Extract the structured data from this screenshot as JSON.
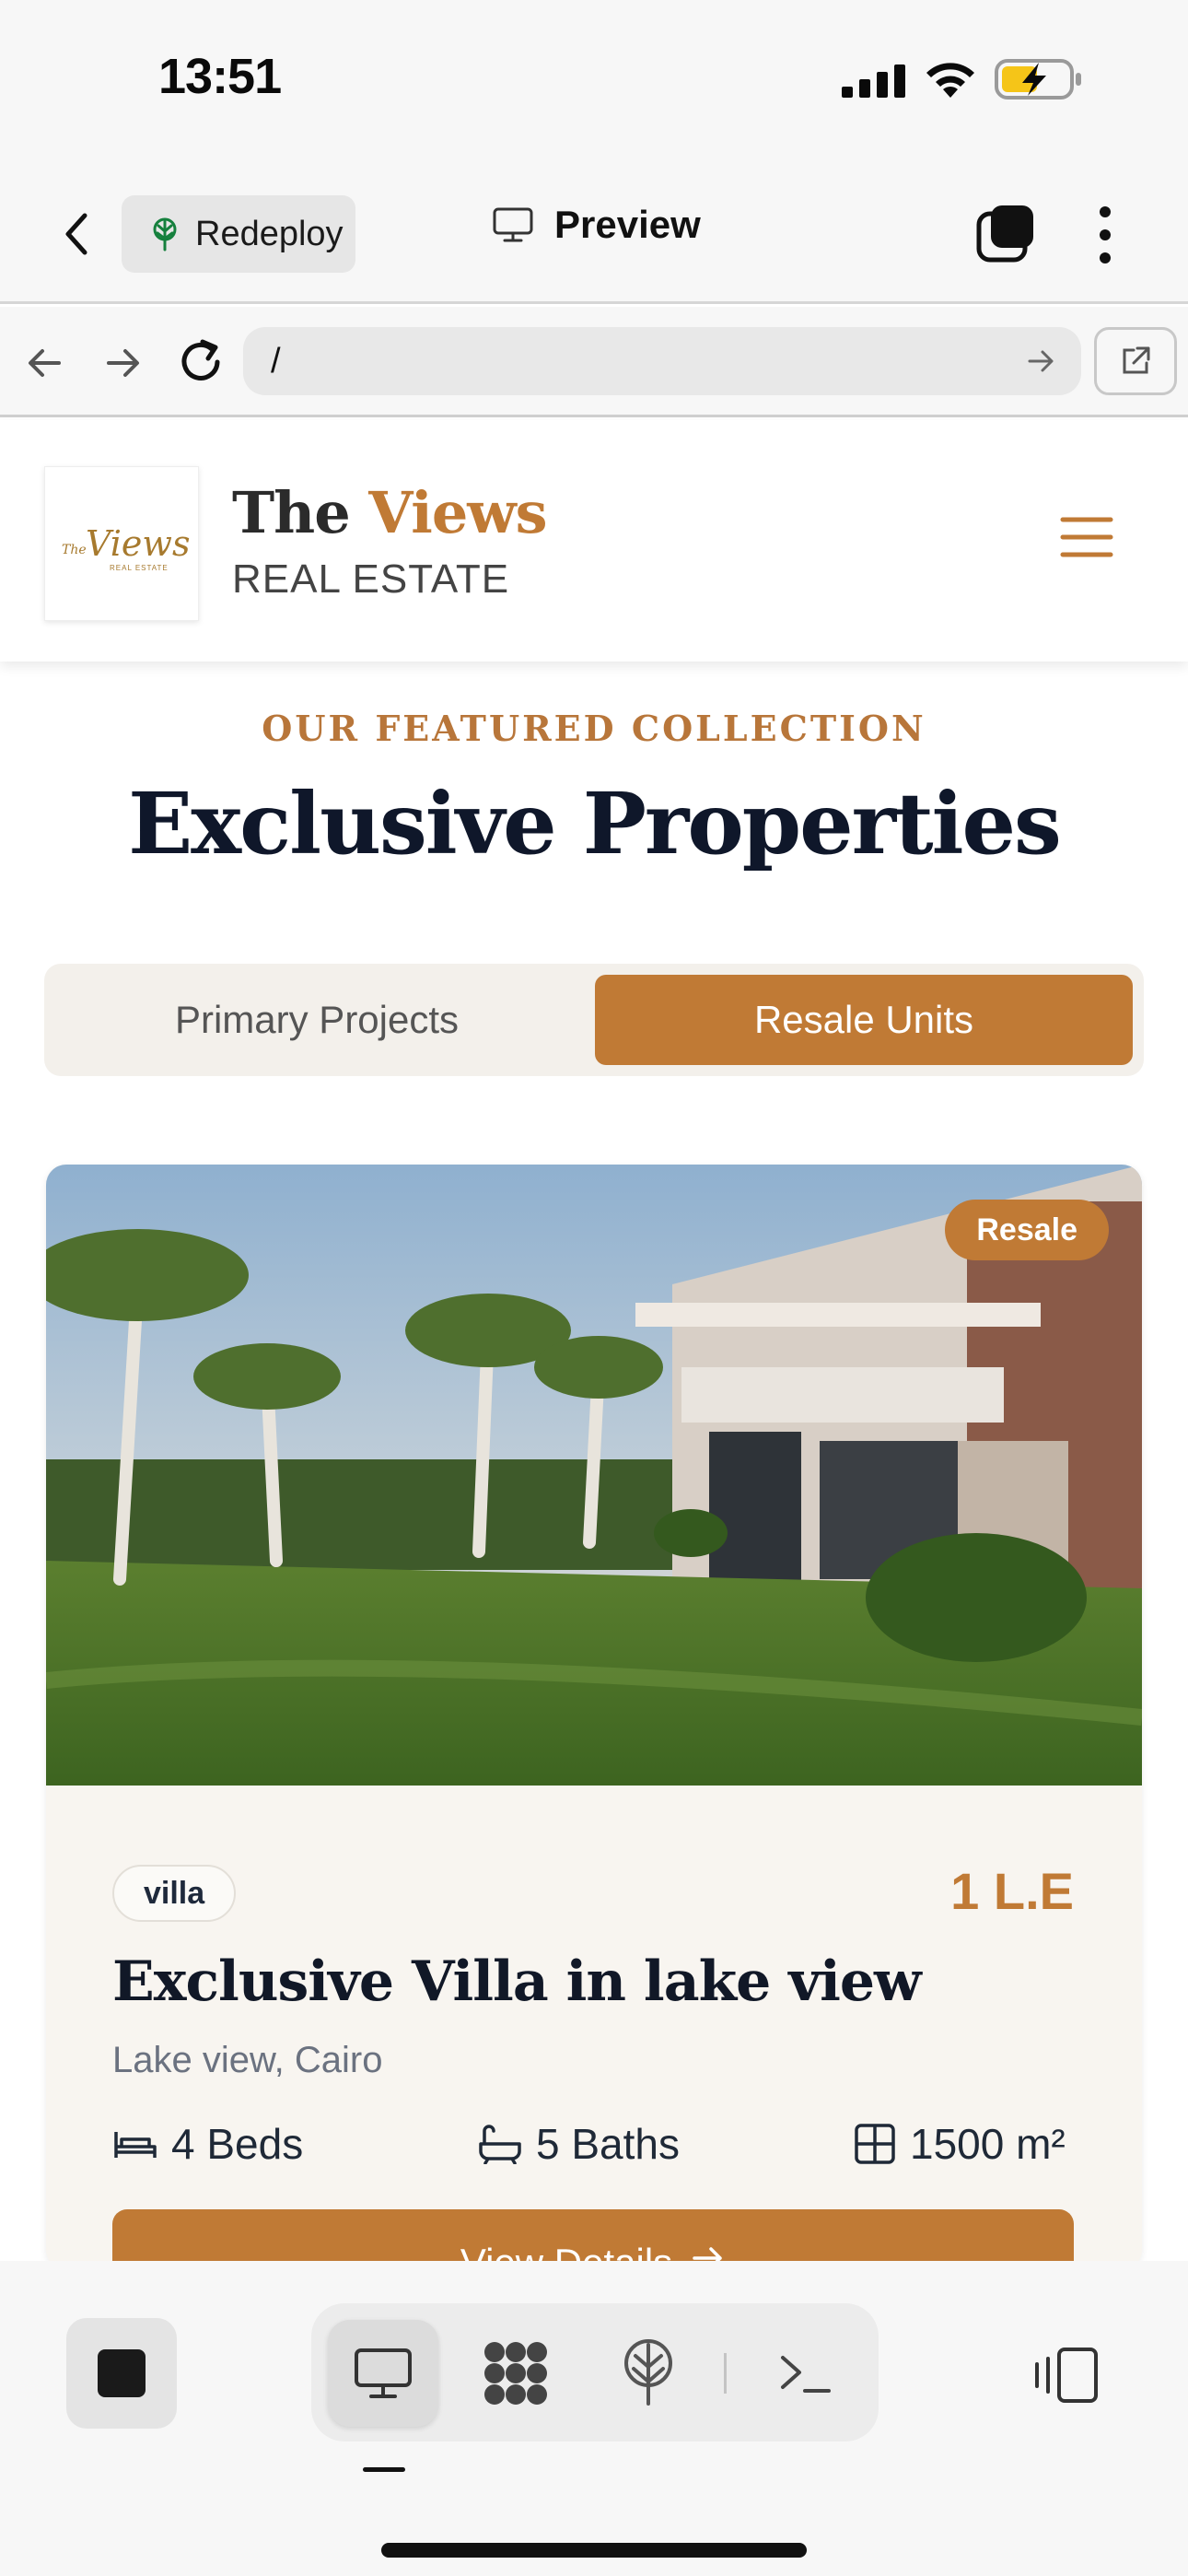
{
  "status_bar": {
    "time": "13:51"
  },
  "toolbar": {
    "redeploy_label": "Redeploy",
    "preview_label": "Preview"
  },
  "browser": {
    "url": "/"
  },
  "site": {
    "brand_first": "The ",
    "brand_accent": "Views",
    "brand_sub": "REAL ESTATE",
    "logo_script": "The Views",
    "logo_tagline": "REAL ESTATE"
  },
  "hero": {
    "eyebrow": "OUR FEATURED COLLECTION",
    "title": "Exclusive Properties"
  },
  "tabs": [
    {
      "label": "Primary Projects",
      "active": false
    },
    {
      "label": "Resale Units",
      "active": true
    }
  ],
  "property": {
    "badge": "Resale",
    "type": "villa",
    "price": "1 L.E",
    "title": "Exclusive Villa in lake view",
    "location": "Lake view, Cairo",
    "beds": "4 Beds",
    "baths": "5 Baths",
    "area": "1500 m²",
    "cta": "View Details"
  },
  "colors": {
    "accent": "#c07a35",
    "navy": "#0f172a",
    "card_bg": "#f8f5f0"
  }
}
